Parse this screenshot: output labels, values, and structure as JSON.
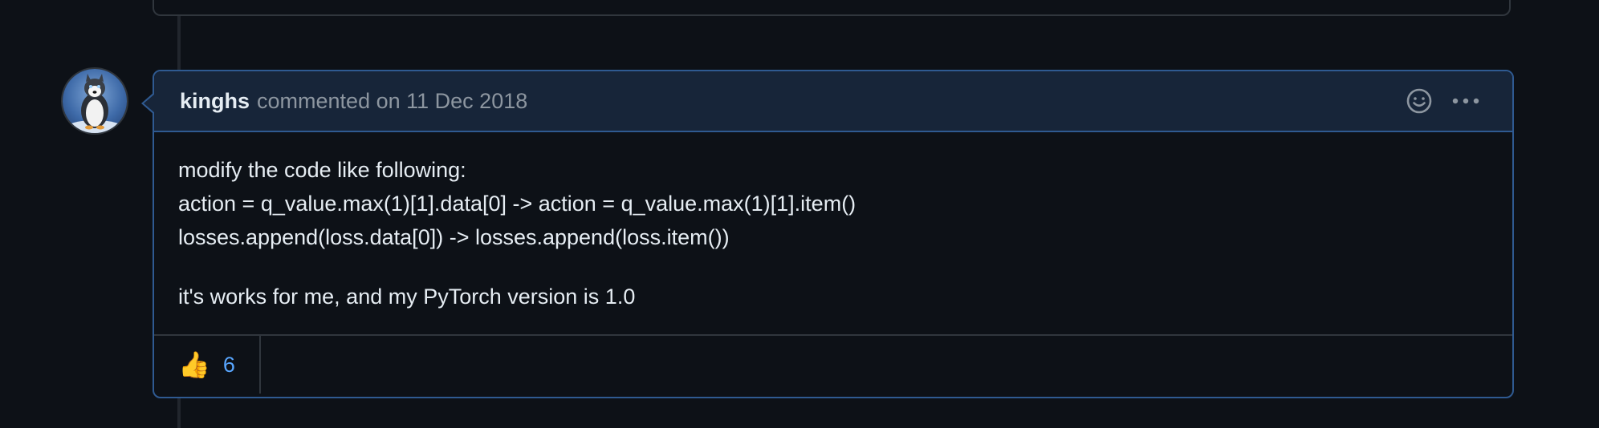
{
  "comment": {
    "author": "kinghs",
    "action_text": "commented on",
    "date": "11 Dec 2018",
    "body_lines": [
      "modify the code like following:",
      "action = q_value.max(1)[1].data[0] -> action = q_value.max(1)[1].item()",
      "losses.append(loss.data[0]) -> losses.append(loss.item())"
    ],
    "body_paragraph_2": "it's works for me, and my PyTorch version is 1.0",
    "reactions": [
      {
        "emoji": "👍",
        "icon": "thumbs-up-icon",
        "count": "6"
      }
    ]
  },
  "icons": {
    "header": [
      "smiley-icon",
      "kebab-menu-icon"
    ],
    "avatar": "husky-penguin-avatar"
  },
  "colors": {
    "background": "#0d1117",
    "header_bg": "#172539",
    "accent_border": "#2f5a91",
    "link": "#58a6ff",
    "muted_text": "#8d96a0"
  }
}
